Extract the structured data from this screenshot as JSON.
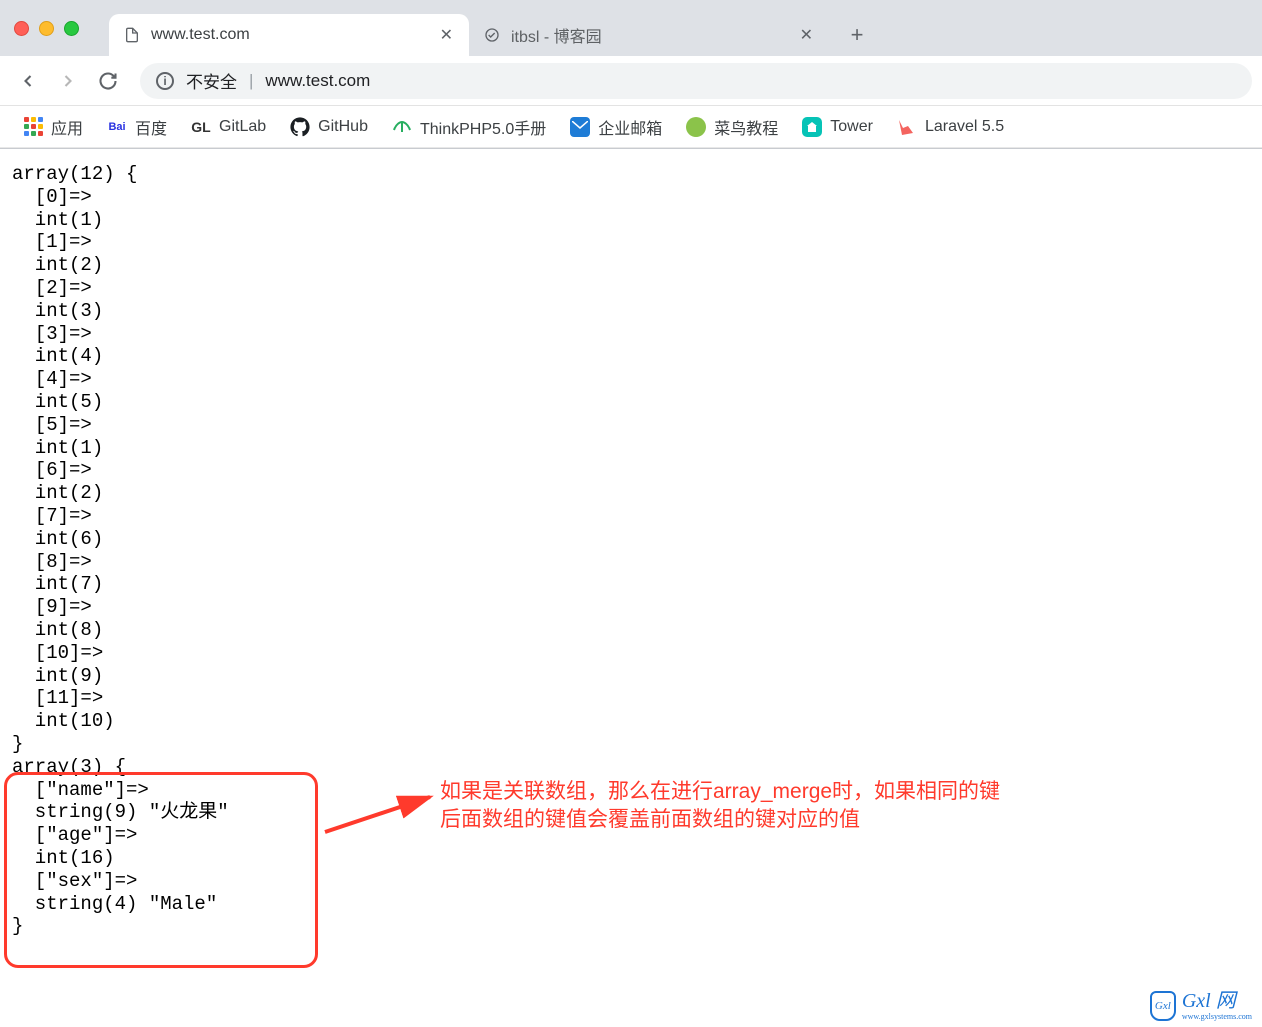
{
  "tabs": [
    {
      "title": "www.test.com",
      "active": true
    },
    {
      "title": "itbsl - 博客园",
      "active": false
    }
  ],
  "omnibox": {
    "security_label": "不安全",
    "url": "www.test.com"
  },
  "bookmarks": [
    {
      "label": "应用",
      "icon": "apps"
    },
    {
      "label": "百度",
      "icon": "baidu"
    },
    {
      "label": "GitLab",
      "icon": "gl"
    },
    {
      "label": "GitHub",
      "icon": "github"
    },
    {
      "label": "ThinkPHP5.0手册",
      "icon": "thinkphp"
    },
    {
      "label": "企业邮箱",
      "icon": "mail"
    },
    {
      "label": "菜鸟教程",
      "icon": "runoob"
    },
    {
      "label": "Tower",
      "icon": "tower"
    },
    {
      "label": "Laravel 5.5",
      "icon": "laravel"
    }
  ],
  "page_output": {
    "array1": "array(12) {\n  [0]=>\n  int(1)\n  [1]=>\n  int(2)\n  [2]=>\n  int(3)\n  [3]=>\n  int(4)\n  [4]=>\n  int(5)\n  [5]=>\n  int(1)\n  [6]=>\n  int(2)\n  [7]=>\n  int(6)\n  [8]=>\n  int(7)\n  [9]=>\n  int(8)\n  [10]=>\n  int(9)\n  [11]=>\n  int(10)\n}",
    "array2": "array(3) {\n  [\"name\"]=>\n  string(9) \"火龙果\"\n  [\"age\"]=>\n  int(16)\n  [\"sex\"]=>\n  string(4) \"Male\"\n}"
  },
  "annotation": {
    "line1": "如果是关联数组，那么在进行array_merge时，如果相同的键",
    "line2": "后面数组的键值会覆盖前面数组的键对应的值"
  },
  "watermark": {
    "badge": "Gxl",
    "main": "Gxl 网",
    "sub": "www.gxlsystems.com"
  }
}
